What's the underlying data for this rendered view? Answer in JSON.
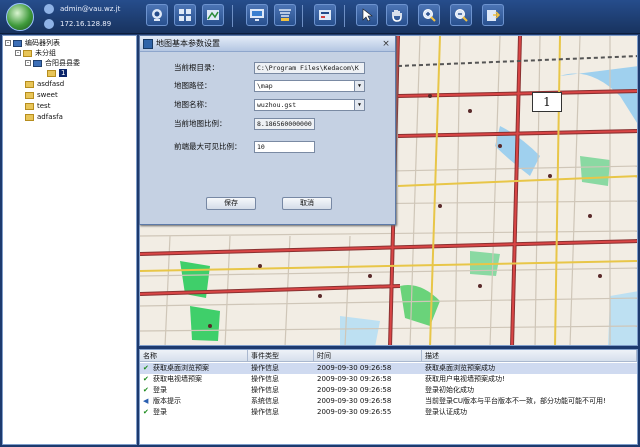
{
  "user": {
    "name": "admin@vau.wz.jt",
    "ip": "172.16.128.89"
  },
  "toolbar": [
    "camera-icon",
    "grid-layout-icon",
    "map-view-icon",
    "screen-monitor-icon",
    "broadcast-icon",
    "dvr-icon",
    "pointer-icon",
    "hand-pan-icon",
    "zoom-in-icon",
    "zoom-out-icon",
    "export-icon"
  ],
  "tree": {
    "root": "编码器列表",
    "items": [
      {
        "label": "未分组",
        "level": 1,
        "icon": "folder"
      },
      {
        "label": "合阳县县委",
        "level": 2,
        "icon": "monitor"
      },
      {
        "label": "1",
        "level": 3,
        "icon": "folder"
      },
      {
        "label": "asdfasd",
        "level": 1,
        "icon": "folder"
      },
      {
        "label": "sweet",
        "level": 1,
        "icon": "folder"
      },
      {
        "label": "test",
        "level": 1,
        "icon": "folder"
      },
      {
        "label": "adfasfa",
        "level": 1,
        "icon": "folder"
      }
    ]
  },
  "dialog": {
    "title": "地图基本参数设置",
    "close": "×",
    "dir_label": "当前根目录：",
    "dir_value": "C:\\Program Files\\Kedacom\\K",
    "path_label": "地图路径：",
    "path_value": "\\map",
    "name_label": "地图名称：",
    "name_value": "wuzhou.gst",
    "scale_label": "当前地图比例：",
    "scale_value": "8.186560000000",
    "maxscale_label": "前端最大可见比例：",
    "maxscale_value": "10",
    "save": "保存",
    "cancel": "取消"
  },
  "map": {
    "box_label": "1"
  },
  "log": {
    "headers": [
      "名称",
      "事件类型",
      "时间",
      "描述"
    ],
    "rows": [
      {
        "icon": "check",
        "name": "获取桌面浏览预案",
        "type": "操作信息",
        "time": "2009-09-30 09:26:58",
        "desc": "获取桌面浏览预案成功"
      },
      {
        "icon": "check",
        "name": "获取电视墙预案",
        "type": "操作信息",
        "time": "2009-09-30 09:26:58",
        "desc": "获取用户电视墙预案成功!"
      },
      {
        "icon": "check",
        "name": "登录",
        "type": "操作信息",
        "time": "2009-09-30 09:26:58",
        "desc": "登录初始化成功"
      },
      {
        "icon": "speaker",
        "name": "版本提示",
        "type": "系统信息",
        "time": "2009-09-30 09:26:58",
        "desc": "当前登录CU版本与平台版本不一致，部分功能可能不可用!"
      },
      {
        "icon": "check",
        "name": "登录",
        "type": "操作信息",
        "time": "2009-09-30 09:26:55",
        "desc": "登录认证成功"
      }
    ]
  }
}
